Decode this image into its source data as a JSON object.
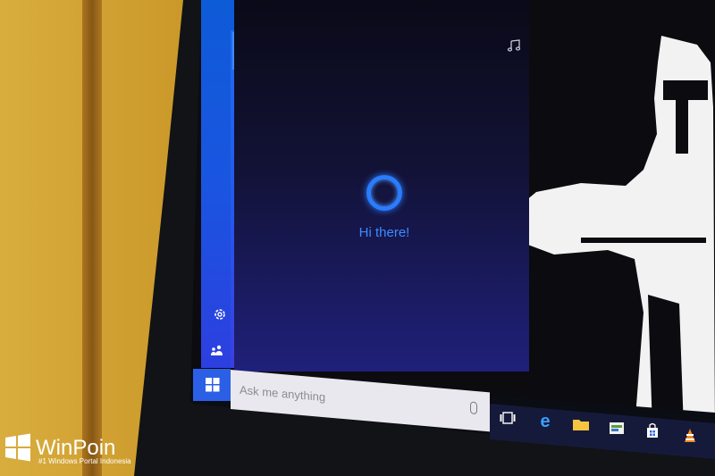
{
  "cortana": {
    "greeting": "Hi there!",
    "search_placeholder": "Ask me anything",
    "accent_color": "#2a7cff"
  },
  "rail": {
    "items": [
      {
        "name": "home",
        "icon": "home-icon"
      },
      {
        "name": "notebook",
        "icon": "notebook-icon"
      },
      {
        "name": "settings",
        "icon": "gear-icon"
      },
      {
        "name": "feedback",
        "icon": "feedback-icon"
      }
    ],
    "top_icon": "hamburger-icon"
  },
  "taskbar": {
    "icons": [
      "task-view-icon",
      "edge-icon",
      "file-explorer-icon",
      "store-icon",
      "windows-store-bag-icon",
      "vlc-icon"
    ]
  },
  "watermark": {
    "title": "WinPoin",
    "subtitle": "#1 Windows Portal Indonesia"
  },
  "panel_top_icon": "music-note-icon"
}
